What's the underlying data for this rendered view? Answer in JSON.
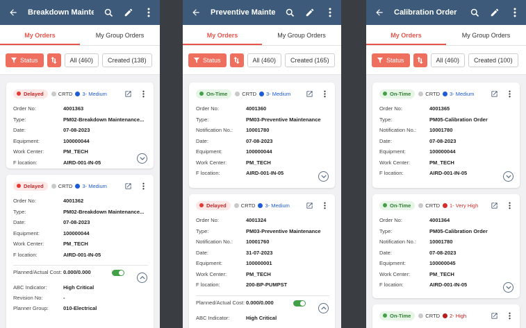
{
  "colors": {
    "appbar": "#3d5a7a",
    "accent": "#e8534a",
    "delayed": "#e53935",
    "ontime": "#43a047",
    "medium": "#1e5bd6",
    "veryhigh": "#d32f2f",
    "high": "#b71c1c"
  },
  "screens": [
    {
      "title": "Breakdown Mainten...",
      "tabs": [
        "My Orders",
        "My Group Orders"
      ],
      "filters": {
        "status": "Status",
        "chips": [
          "All (460)",
          "Created (138)"
        ]
      },
      "cards": [
        {
          "status": "Delayed",
          "crtd": "CRTD",
          "priority": "3- Medium",
          "fields": [
            {
              "k": "Order No:",
              "v": "4001363"
            },
            {
              "k": "Type:",
              "v": "PM02-Breakdown Maintenance..."
            },
            {
              "k": "Date:",
              "v": "07-08-2023"
            },
            {
              "k": "Equipment:",
              "v": "100000044"
            },
            {
              "k": "Work Center:",
              "v": "PM_TECH"
            },
            {
              "k": "F location:",
              "v": "AIRD-001-IN-05"
            }
          ]
        },
        {
          "status": "Delayed",
          "crtd": "CRTD",
          "priority": "3- Medium",
          "fields": [
            {
              "k": "Order No:",
              "v": "4001362"
            },
            {
              "k": "Type:",
              "v": "PM02-Breakdown Maintenance..."
            },
            {
              "k": "Date:",
              "v": "07-08-2023"
            },
            {
              "k": "Equipment:",
              "v": "100000044"
            },
            {
              "k": "Work Center:",
              "v": "PM_TECH"
            },
            {
              "k": "F location:",
              "v": "AIRD-001-IN-05"
            }
          ],
          "extra": [
            {
              "k": "Planned/Actual Cost:",
              "v": "0.000/0.000"
            },
            {
              "k": "ABC Indicator:",
              "v": "High Critical"
            },
            {
              "k": "Revision No:",
              "v": "-"
            },
            {
              "k": "Planner Group:",
              "v": "010-Electrical"
            }
          ]
        }
      ]
    },
    {
      "title": "Preventive Mainten...",
      "tabs": [
        "My Orders",
        "My Group Orders"
      ],
      "filters": {
        "status": "Status",
        "chips": [
          "All (460)",
          "Created (165)"
        ]
      },
      "cards": [
        {
          "status": "On-Time",
          "crtd": "CRTD",
          "priority": "3- Medium",
          "fields": [
            {
              "k": "Order No:",
              "v": "4001360"
            },
            {
              "k": "Type:",
              "v": "PM03-Preventive Maintenance"
            },
            {
              "k": "Notification No.:",
              "v": "10001780"
            },
            {
              "k": "Date:",
              "v": "07-08-2023"
            },
            {
              "k": "Equipment:",
              "v": "100000044"
            },
            {
              "k": "Work Center:",
              "v": "PM_TECH"
            },
            {
              "k": "F location:",
              "v": "AIRD-001-IN-05"
            }
          ]
        },
        {
          "status": "Delayed",
          "crtd": "CRTD",
          "priority": "3- Medium",
          "fields": [
            {
              "k": "Order No:",
              "v": "4001324"
            },
            {
              "k": "Type:",
              "v": "PM03-Preventive Maintenance"
            },
            {
              "k": "Notification No.:",
              "v": "10001760"
            },
            {
              "k": "Date:",
              "v": "31-07-2023"
            },
            {
              "k": "Equipment:",
              "v": "100000001"
            },
            {
              "k": "Work Center:",
              "v": "PM_TECH"
            },
            {
              "k": "F location:",
              "v": "200-BP-PUMPST"
            }
          ],
          "extra": [
            {
              "k": "Planned/Actual Cost:",
              "v": "0.000/0.000"
            },
            {
              "k": "ABC Indicator:",
              "v": "High Critical"
            }
          ]
        }
      ]
    },
    {
      "title": "Calibration Order",
      "tabs": [
        "My Orders",
        "My Group Orders"
      ],
      "filters": {
        "status": "Status",
        "chips": [
          "All (460)",
          "Created (100)"
        ]
      },
      "cards": [
        {
          "status": "On-Time",
          "crtd": "CRTD",
          "priority": "3- Medium",
          "fields": [
            {
              "k": "Order No:",
              "v": "4001365"
            },
            {
              "k": "Type:",
              "v": "PM05-Calibration Order"
            },
            {
              "k": "Notification No.:",
              "v": "10001780"
            },
            {
              "k": "Date:",
              "v": "07-08-2023"
            },
            {
              "k": "Equipment:",
              "v": "100000044"
            },
            {
              "k": "Work Center:",
              "v": "PM_TECH"
            },
            {
              "k": "F location:",
              "v": "AIRD-001-IN-05"
            }
          ]
        },
        {
          "status": "On-Time",
          "crtd": "CRTD",
          "priority": "1- Very High",
          "fields": [
            {
              "k": "Order No:",
              "v": "4001364"
            },
            {
              "k": "Type:",
              "v": "PM05-Calibration Order"
            },
            {
              "k": "Notification No.:",
              "v": "10001780"
            },
            {
              "k": "Date:",
              "v": "07-08-2023"
            },
            {
              "k": "Equipment:",
              "v": "100000045"
            },
            {
              "k": "Work Center:",
              "v": "PM_TECH"
            },
            {
              "k": "F location:",
              "v": "AIRD-001-IN-05"
            }
          ]
        },
        {
          "status": "On-Time",
          "crtd": "CRTD",
          "priority": "2- High",
          "fields": []
        }
      ]
    }
  ]
}
